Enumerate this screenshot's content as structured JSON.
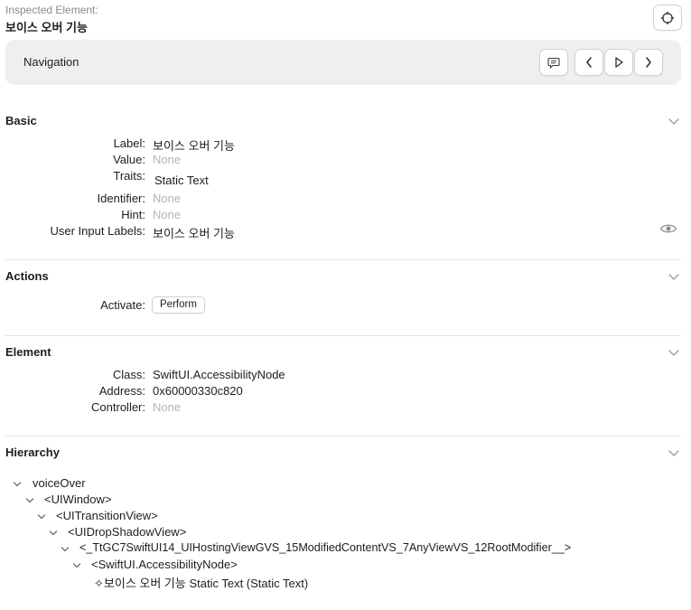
{
  "header": {
    "inspected_label": "Inspected Element:",
    "inspected_value": "보이스 오버 기능"
  },
  "navigation": {
    "title": "Navigation"
  },
  "sections": {
    "basic": {
      "title": "Basic",
      "rows": [
        {
          "label": "Label:",
          "value": "보이스 오버 기능"
        },
        {
          "label": "Value:",
          "value": "None"
        },
        {
          "label": "Traits:",
          "value": "Static Text"
        },
        {
          "label": "Identifier:",
          "value": "None"
        },
        {
          "label": "Hint:",
          "value": "None"
        },
        {
          "label": "User Input Labels:",
          "value": "보이스 오버 기능"
        }
      ]
    },
    "actions": {
      "title": "Actions",
      "activate_label": "Activate:",
      "perform_label": "Perform"
    },
    "element": {
      "title": "Element",
      "rows": [
        {
          "label": "Class:",
          "value": "SwiftUI.AccessibilityNode"
        },
        {
          "label": "Address:",
          "value": "0x60000330c820"
        },
        {
          "label": "Controller:",
          "value": "None"
        }
      ]
    },
    "hierarchy": {
      "title": "Hierarchy",
      "nodes": [
        "voiceOver",
        "<UIWindow>",
        "<UITransitionView>",
        "<UIDropShadowView>",
        "<_TtGC7SwiftUI14_UIHostingViewGVS_15ModifiedContentVS_7AnyViewVS_12RootModifier__>",
        "<SwiftUI.AccessibilityNode>",
        "✧보이스 오버 기능 Static Text (Static Text)"
      ]
    }
  },
  "icons": {
    "target": "crosshair-icon",
    "speech": "speech-bubble-icon",
    "previous": "chevron-left-icon",
    "play": "play-icon",
    "next": "chevron-right-icon",
    "eye": "eye-icon",
    "collapse": "chevron-down-icon"
  }
}
